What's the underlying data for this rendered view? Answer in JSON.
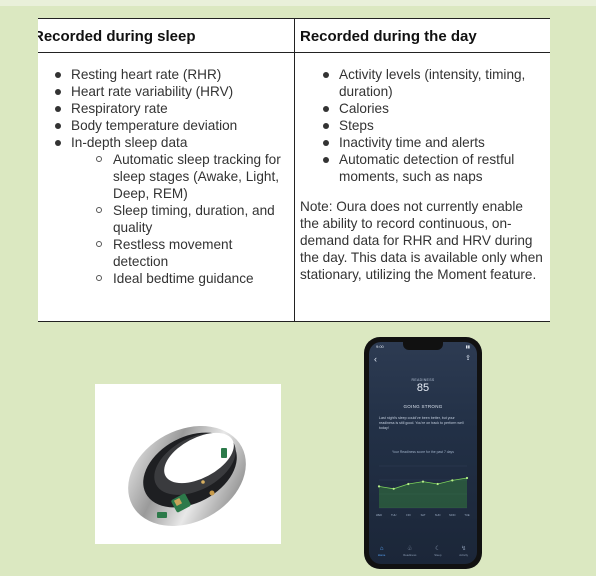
{
  "table": {
    "left_header": "Recorded during sleep",
    "right_header": "Recorded during the day",
    "left_items": [
      {
        "text": "Resting heart rate (RHR)"
      },
      {
        "text": "Heart rate variability (HRV)"
      },
      {
        "text": "Respiratory rate"
      },
      {
        "text": "Body temperature deviation"
      },
      {
        "text": "In-depth sleep data",
        "sub": [
          "Automatic sleep tracking for sleep stages (Awake, Light, Deep, REM)",
          "Sleep timing, duration, and quality",
          "Restless movement detection",
          "Ideal bedtime guidance"
        ]
      }
    ],
    "right_items": [
      "Activity levels (intensity, timing, duration)",
      "Calories",
      "Steps",
      "Inactivity time and alerts",
      "Automatic detection of restful moments, such as naps"
    ],
    "note": "Note: Oura does not currently enable the ability to record continuous, on-demand data for RHR and HRV during the day. This data is available only when stationary, utilizing the Moment feature."
  },
  "phone": {
    "time": "9:00",
    "readiness_label": "READINESS",
    "readiness_score": "85",
    "status": "GOING STRONG",
    "message": "Last night's sleep could've been better, but your readiness is still good. You're on track to perform well today!",
    "trend_caption": "Your Readiness score for the past 7 days",
    "days": [
      "WED",
      "THU",
      "FRI",
      "SAT",
      "SUN",
      "MON",
      "TUE"
    ],
    "tabs": [
      {
        "label": "Home",
        "icon": "home-icon"
      },
      {
        "label": "Readiness",
        "icon": "readiness-icon"
      },
      {
        "label": "Sleep",
        "icon": "sleep-icon"
      },
      {
        "label": "Activity",
        "icon": "activity-icon"
      }
    ]
  },
  "chart_data": {
    "type": "area",
    "x": [
      "WED",
      "THU",
      "FRI",
      "SAT",
      "SUN",
      "MON",
      "TUE"
    ],
    "values": [
      78,
      76,
      80,
      82,
      80,
      83,
      85
    ],
    "ylim": [
      60,
      95
    ],
    "color": "#3fa33c"
  }
}
